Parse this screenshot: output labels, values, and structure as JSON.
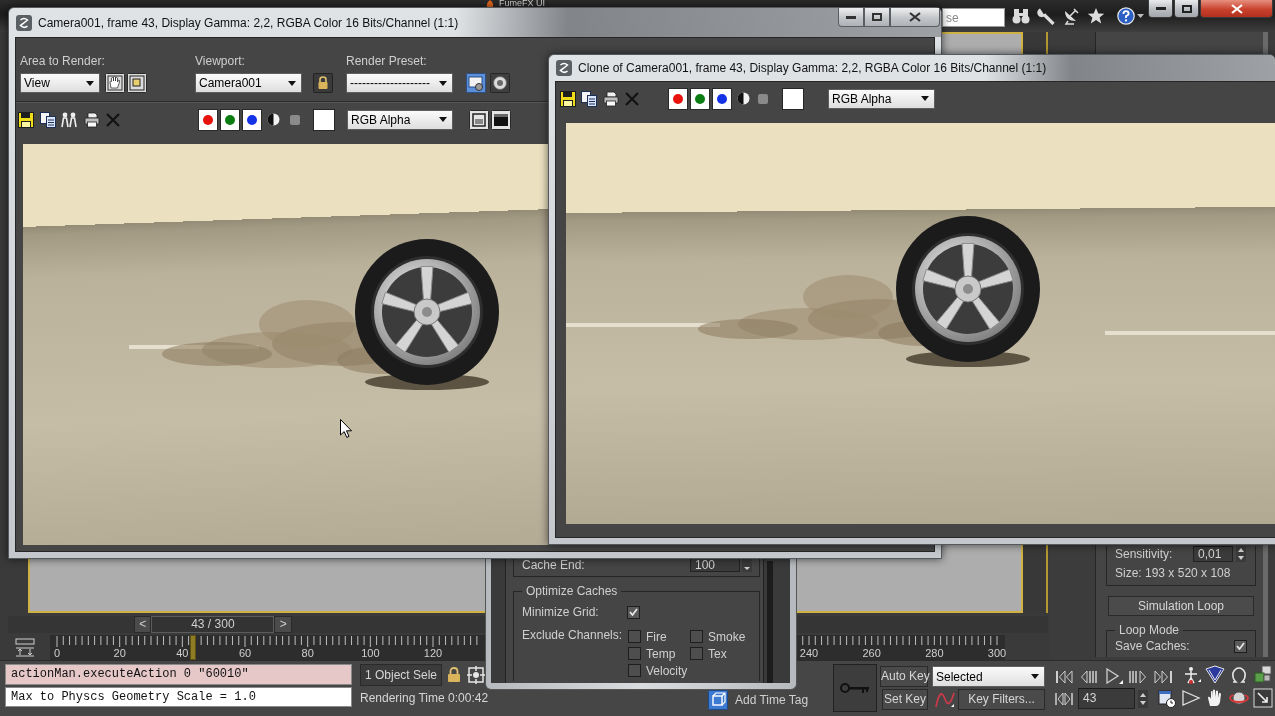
{
  "main_window": {
    "behind_window_title": "FumeFX UI",
    "search": {
      "placeholder": "se"
    },
    "command_panel": {
      "sensitivity": {
        "label": "Sensitivity:",
        "value": "0,01"
      },
      "size": "Size: 193 x 520 x 108",
      "simulation_loop_button": "Simulation Loop",
      "loop_mode": {
        "title": "Loop Mode",
        "save_caches": {
          "label": "Save Caches:",
          "checked": true
        }
      }
    },
    "time_slider": {
      "previous": "<",
      "label": "43 / 300",
      "next": ">",
      "level": 0.1433
    },
    "timeline": {
      "labels_start": [
        "0",
        "20",
        "40",
        "60",
        "80",
        "100",
        "120"
      ],
      "labels_end": [
        "240",
        "260",
        "280",
        "300"
      ]
    },
    "listener": {
      "command": "actionMan.executeAction 0 \"60010\"",
      "output": "Max to Physcs Geometry Scale = 1.0"
    },
    "status": {
      "selection": "1 Object Sele",
      "rendering_time": "Rendering Time 0:00:42",
      "time_tag": "Add Time Tag"
    },
    "animation_controls": {
      "auto_key": "Auto Key",
      "set_key": "Set Key",
      "key_set": "Selected",
      "key_filters": "Key Filters...",
      "current_frame": "43"
    }
  },
  "fumefx_panel": {
    "cache_end": {
      "label": "Cache End:",
      "value": "100"
    },
    "optimize_caches": {
      "title": "Optimize Caches",
      "minimize_grid": {
        "label": "Minimize Grid:",
        "checked": true
      },
      "exclude_channels": {
        "label": "Exclude Channels:",
        "options": [
          {
            "label": "Fire",
            "checked": false
          },
          {
            "label": "Smoke",
            "checked": false
          },
          {
            "label": "Temp",
            "checked": false
          },
          {
            "label": "Tex",
            "checked": false
          },
          {
            "label": "Velocity",
            "checked": false
          }
        ]
      }
    }
  },
  "render_window": {
    "title": "Camera001, frame 43, Display Gamma: 2,2, RGBA Color 16 Bits/Channel (1:1)",
    "area_to_render": {
      "label": "Area to Render:",
      "value": "View"
    },
    "viewport": {
      "label": "Viewport:",
      "value": "Camera001"
    },
    "render_preset": {
      "label": "Render Preset:",
      "value": "--------------------"
    },
    "channels": [
      {
        "color": "#e8120c"
      },
      {
        "color": "#0b7d12"
      },
      {
        "color": "#1432e6"
      }
    ],
    "display_channel": "RGB Alpha"
  },
  "clone_window": {
    "title": "Clone of Camera001, frame 43, Display Gamma: 2,2, RGBA Color 16 Bits/Channel (1:1)",
    "channels": [
      {
        "color": "#e8120c"
      },
      {
        "color": "#0b7d12"
      },
      {
        "color": "#1432e6"
      }
    ],
    "display_channel": "RGB Alpha"
  }
}
